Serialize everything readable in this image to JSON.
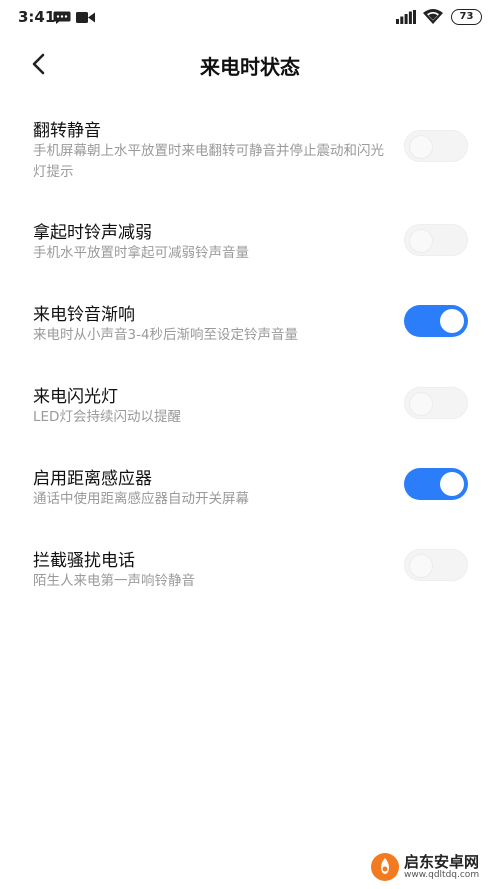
{
  "status_bar": {
    "time": "3:41",
    "icons": [
      "message-icon",
      "video-icon",
      "signal-icon",
      "wifi-icon"
    ],
    "battery": "73"
  },
  "header": {
    "back_icon": "back-arrow-icon",
    "title": "来电时状态"
  },
  "settings": [
    {
      "title": "翻转静音",
      "description": "手机屏幕朝上水平放置时来电翻转可静音并停止震动和闪光灯提示",
      "enabled": false
    },
    {
      "title": "拿起时铃声减弱",
      "description": "手机水平放置时拿起可减弱铃声音量",
      "enabled": false
    },
    {
      "title": "来电铃音渐响",
      "description": "来电时从小声音3-4秒后渐响至设定铃声音量",
      "enabled": true
    },
    {
      "title": "来电闪光灯",
      "description": "LED灯会持续闪动以提醒",
      "enabled": false
    },
    {
      "title": "启用距离感应器",
      "description": "通话中使用距离感应器自动开关屏幕",
      "enabled": true
    },
    {
      "title": "拦截骚扰电话",
      "description": "陌生人来电第一声响铃静音",
      "enabled": false
    }
  ],
  "colors": {
    "accent": "#2c7dfa",
    "toggle_off": "#f4f4f4",
    "description_text": "#9a9a9a"
  },
  "watermark": {
    "name": "启东安卓网",
    "url": "www.qdltdq.com"
  }
}
